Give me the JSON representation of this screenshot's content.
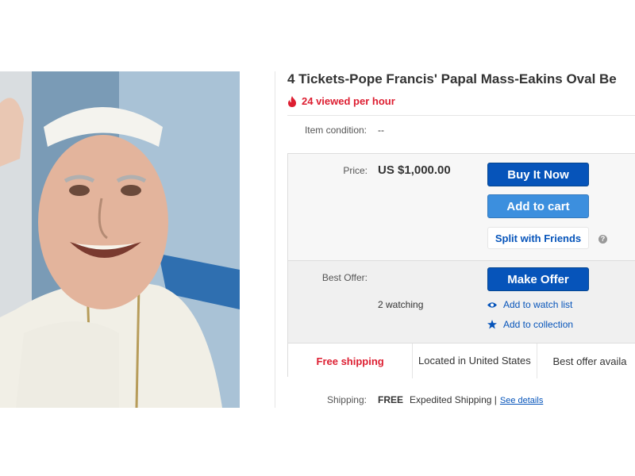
{
  "listing": {
    "title": "4 Tickets-Pope Francis' Papal Mass-Eakins Oval Be",
    "viewed_text": "24 viewed per hour"
  },
  "condition": {
    "label": "Item condition:",
    "value": "--"
  },
  "price": {
    "label": "Price:",
    "value": "US $1,000.00",
    "buy_now_label": "Buy It Now",
    "add_to_cart_label": "Add to cart",
    "split_label": "Split with Friends",
    "help_glyph": "?"
  },
  "offer": {
    "label": "Best Offer:",
    "make_offer_label": "Make Offer",
    "watching_text": "2 watching",
    "watch_list_label": "Add to watch list",
    "collection_label": "Add to collection"
  },
  "shipping_summary": {
    "free_shipping": "Free shipping",
    "location": "Located in United States",
    "best_offer": "Best offer availa"
  },
  "shipping": {
    "label": "Shipping:",
    "free": "FREE",
    "method": "Expedited Shipping |",
    "see_details": "See details"
  },
  "colors": {
    "primary_blue": "#0654ba",
    "light_blue": "#3c8fde",
    "alert_red": "#dd1e31"
  },
  "icons": [
    "fire-icon",
    "eye-icon",
    "star-icon",
    "help-icon"
  ]
}
